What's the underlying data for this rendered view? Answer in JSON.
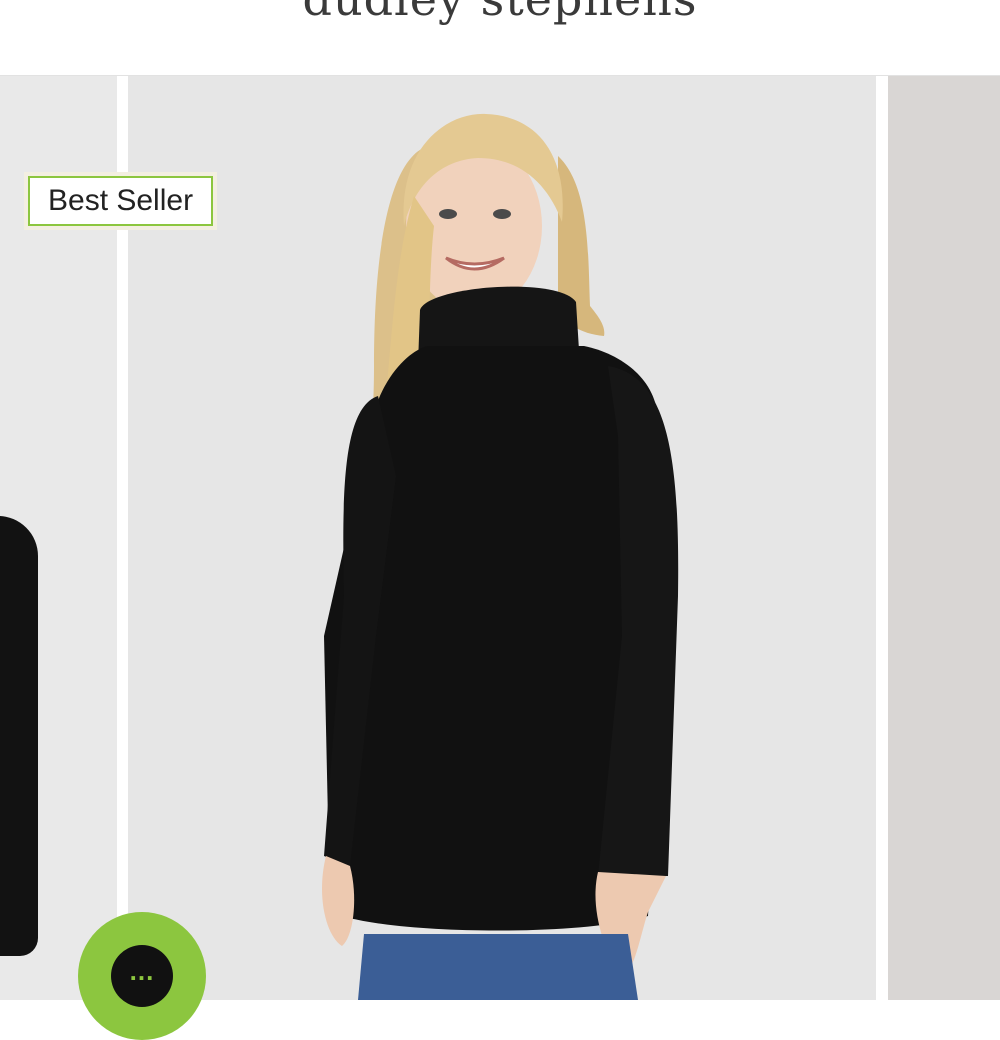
{
  "header": {
    "brand": "dudley stephens"
  },
  "product_gallery": {
    "badge_label": "Best Seller",
    "main_image": "model-black-turtleneck-tunic-photo",
    "prev_image": "partial-black-garment-photo",
    "next_image": "partial-next-slide-photo"
  },
  "chat": {
    "label": "...",
    "icon": "chat-bubble-icon"
  },
  "colors": {
    "accent": "#8cc63f",
    "garment": "#111111",
    "background": "#e6e6e6"
  }
}
